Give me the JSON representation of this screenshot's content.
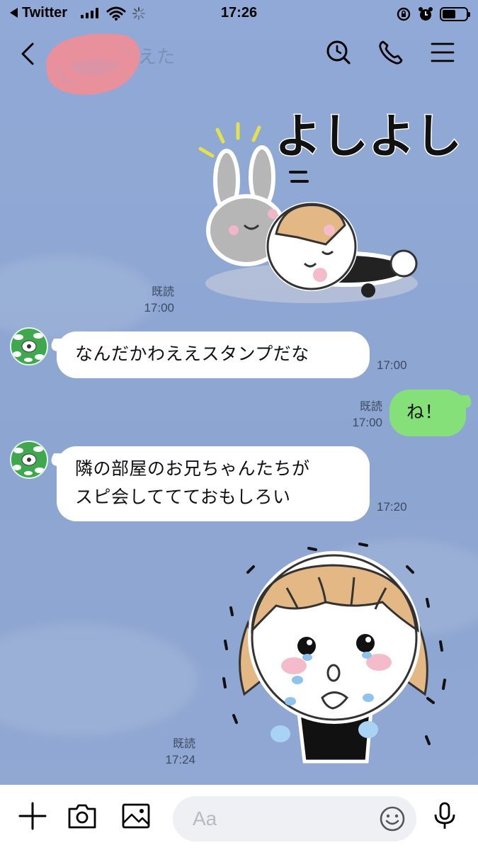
{
  "status_bar": {
    "back_app": "Twitter",
    "time": "17:26"
  },
  "header": {
    "title_fragment": "えた"
  },
  "messages": [
    {
      "type": "sticker",
      "direction": "out",
      "sticker_text": "よしよし",
      "read": "既読",
      "time": "17:00"
    },
    {
      "type": "text",
      "direction": "in",
      "text": "なんだかわええスタンプだな",
      "time": "17:00"
    },
    {
      "type": "text",
      "direction": "out",
      "text": "ね！",
      "read": "既読",
      "time": "17:00"
    },
    {
      "type": "text",
      "direction": "in",
      "lines": [
        "隣の部屋のお兄ちゃんたちが",
        "スピ会しててておもしろい"
      ],
      "time": "17:20"
    },
    {
      "type": "sticker",
      "direction": "out",
      "read": "既読",
      "time": "17:24"
    }
  ],
  "input_bar": {
    "placeholder": "Aa"
  },
  "colors": {
    "background": "#8fa6d0",
    "incoming_bubble": "#ffffff",
    "outgoing_bubble": "#86e07a",
    "avatar_green": "#3fa84e"
  },
  "icons": [
    "search-icon",
    "phone-icon",
    "menu-icon",
    "back-icon",
    "plus-icon",
    "camera-icon",
    "image-icon",
    "emoji-icon",
    "mic-icon"
  ]
}
